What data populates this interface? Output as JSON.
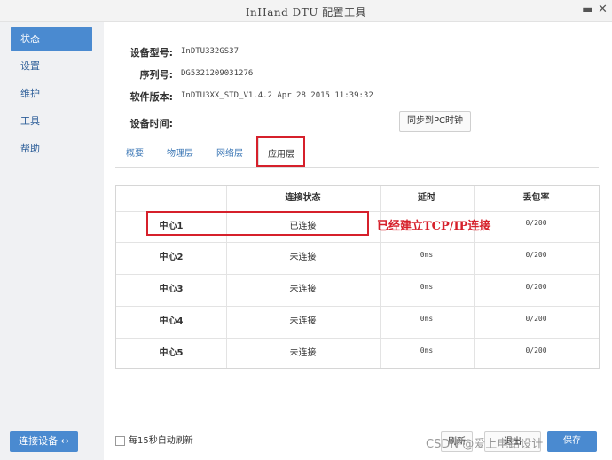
{
  "window": {
    "title": "InHand DTU 配置工具",
    "minimize": "▬",
    "close": "✕"
  },
  "sidebar": {
    "items": [
      {
        "label": "状态",
        "active": true
      },
      {
        "label": "设置",
        "active": false
      },
      {
        "label": "维护",
        "active": false
      },
      {
        "label": "工具",
        "active": false
      },
      {
        "label": "帮助",
        "active": false
      }
    ],
    "connect_button": "连接设备 ↔"
  },
  "device_info": {
    "model_label": "设备型号:",
    "model_value": "InDTU332GS37",
    "serial_label": "序列号:",
    "serial_value": "DG5321209031276",
    "firmware_label": "软件版本:",
    "firmware_value": "InDTU3XX_STD_V1.4.2 Apr 28 2015 11:39:32",
    "time_label": "设备时间:",
    "time_value": "",
    "sync_button": "同步到PC时钟"
  },
  "tabs": [
    {
      "label": "概要",
      "active": false
    },
    {
      "label": "物理层",
      "active": false
    },
    {
      "label": "网络层",
      "active": false
    },
    {
      "label": "应用层",
      "active": true
    }
  ],
  "table": {
    "headers": [
      "",
      "连接状态",
      "延时",
      "丢包率"
    ],
    "rows": [
      {
        "name": "中心1",
        "status": "已连接",
        "delay": "",
        "loss": "0/200"
      },
      {
        "name": "中心2",
        "status": "未连接",
        "delay": "0ms",
        "loss": "0/200"
      },
      {
        "name": "中心3",
        "status": "未连接",
        "delay": "0ms",
        "loss": "0/200"
      },
      {
        "name": "中心4",
        "status": "未连接",
        "delay": "0ms",
        "loss": "0/200"
      },
      {
        "name": "中心5",
        "status": "未连接",
        "delay": "0ms",
        "loss": "0/200"
      }
    ]
  },
  "annotation": {
    "text": "已经建立TCP/IP连接",
    "color": "#d6202b"
  },
  "footer": {
    "auto_refresh": "每15秒自动刷新",
    "refresh_button": "刷新",
    "exit_button": "退出",
    "save_button": "保存",
    "watermark": "CSDN @爱上电路设计"
  },
  "colors": {
    "accent": "#4a8ad0",
    "highlight": "#d6202b",
    "link": "#3a76b5"
  }
}
